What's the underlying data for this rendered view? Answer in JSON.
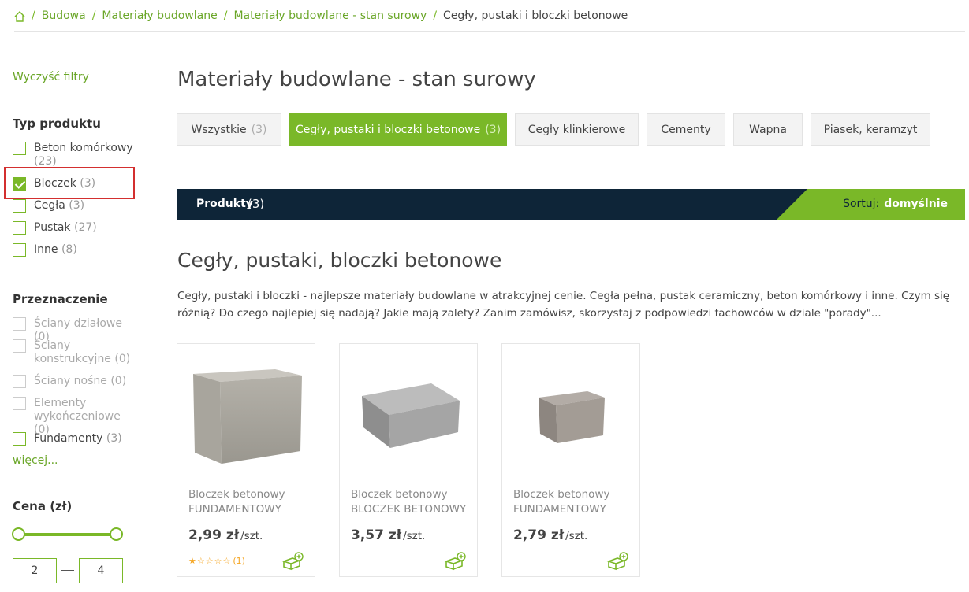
{
  "breadcrumb": {
    "items": [
      "Budowa",
      "Materiały budowlane",
      "Materiały budowlane - stan surowy"
    ],
    "current": "Cegły, pustaki i bloczki betonowe",
    "separator": "/"
  },
  "sidebar": {
    "clear_filters": "Wyczyść filtry",
    "product_type": {
      "title": "Typ produktu",
      "items": [
        {
          "label": "Beton komórkowy",
          "count": "(23)",
          "checked": false
        },
        {
          "label": "Bloczek",
          "count": "(3)",
          "checked": true
        },
        {
          "label": "Cegła",
          "count": "(3)",
          "checked": false
        },
        {
          "label": "Pustak",
          "count": "(27)",
          "checked": false
        },
        {
          "label": "Inne",
          "count": "(8)",
          "checked": false
        }
      ]
    },
    "purpose": {
      "title": "Przeznaczenie",
      "items": [
        {
          "label": "Ściany działowe",
          "count": "(0)",
          "disabled": true
        },
        {
          "label": "Ściany konstrukcyjne",
          "count": "(0)",
          "disabled": true
        },
        {
          "label": "Ściany nośne",
          "count": "(0)",
          "disabled": true
        },
        {
          "label": "Elementy wykończeniowe",
          "count": "(0)",
          "disabled": true
        },
        {
          "label": "Fundamenty",
          "count": "(3)",
          "disabled": false
        }
      ],
      "more": "więcej..."
    },
    "price": {
      "title": "Cena (zł)",
      "min": "2",
      "max": "4"
    }
  },
  "main": {
    "title": "Materiały budowlane - stan surowy",
    "tabs": [
      {
        "label": "Wszystkie",
        "count": "(3)",
        "active": false
      },
      {
        "label": "Cegły, pustaki i bloczki betonowe",
        "count": "(3)",
        "active": true
      },
      {
        "label": "Cegły klinkierowe",
        "count": "",
        "active": false
      },
      {
        "label": "Cementy",
        "count": "",
        "active": false
      },
      {
        "label": "Wapna",
        "count": "",
        "active": false
      },
      {
        "label": "Piasek, keramzyt",
        "count": "",
        "active": false
      }
    ],
    "products_bar": {
      "label": "Produkty",
      "count": "(3)",
      "sort_label": "Sortuj:",
      "sort_value": "domyślnie"
    },
    "category_title": "Cegły, pustaki, bloczki betonowe",
    "category_description": "Cegły, pustaki i bloczki - najlepsze materiały budowlane w atrakcyjnej cenie. Cegła pełna, pustak ceramiczny, beton komórkowy i inne. Czym się różnią? Do czego najlepiej się nadają? Jakie mają zalety? Zanim zamówisz, skorzystaj z podpowiedzi fachowców w dziale \"porady\"...",
    "products": [
      {
        "name1": "Bloczek betonowy",
        "name2": "FUNDAMENTOWY",
        "price": "2,99 zł",
        "unit": "/szt.",
        "rating_stars": 1,
        "rating_count": "(1)"
      },
      {
        "name1": "Bloczek betonowy",
        "name2": "BLOCZEK BETONOWY",
        "price": "3,57 zł",
        "unit": "/szt."
      },
      {
        "name1": "Bloczek betonowy",
        "name2": "FUNDAMENTOWY",
        "price": "2,79 zł",
        "unit": "/szt."
      }
    ]
  },
  "colors": {
    "accent": "#7ab828",
    "dark_bar": "#0e2538",
    "highlight": "#d32f2f"
  }
}
